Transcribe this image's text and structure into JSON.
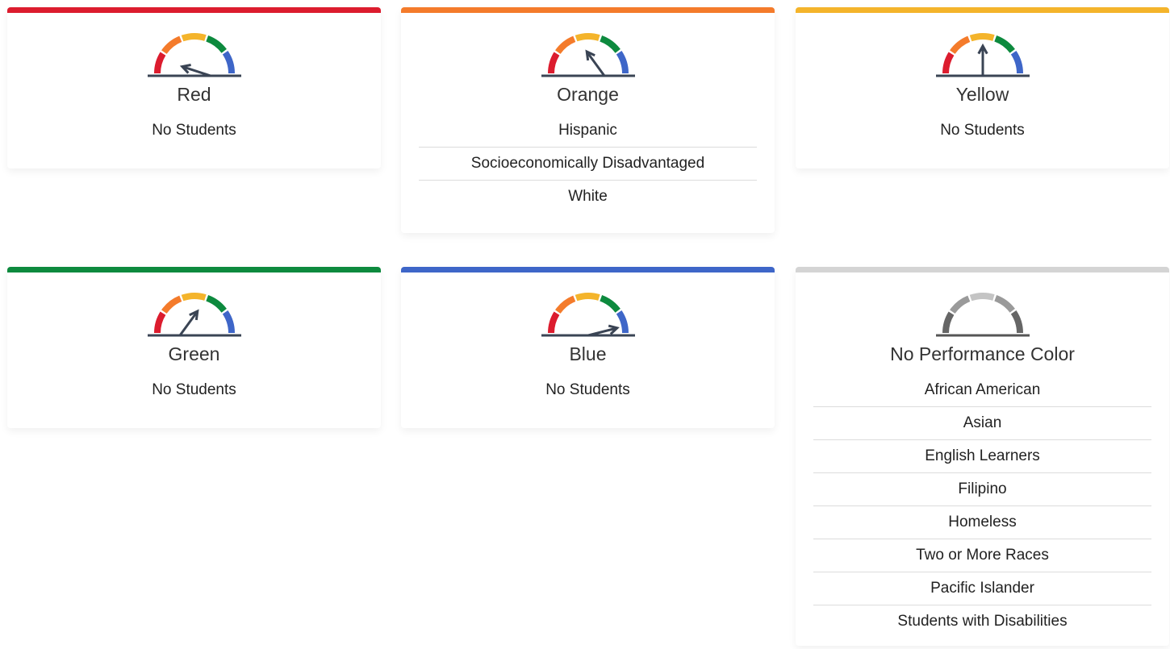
{
  "colors": {
    "red": "#dc1c2e",
    "orange": "#f47b2b",
    "yellow": "#f4b42b",
    "green": "#0d8a3e",
    "blue": "#3e66c8",
    "gray": "#d4d4d4",
    "needle": "#3a4454"
  },
  "cards": [
    {
      "key": "red",
      "title": "Red",
      "students": [
        "No Students"
      ],
      "gauge_level": 0.1
    },
    {
      "key": "orange",
      "title": "Orange",
      "students": [
        "Hispanic",
        "Socioeconomically Disadvantaged",
        "White"
      ],
      "gauge_level": 0.3
    },
    {
      "key": "yellow",
      "title": "Yellow",
      "students": [
        "No Students"
      ],
      "gauge_level": 0.5
    },
    {
      "key": "green",
      "title": "Green",
      "students": [
        "No Students"
      ],
      "gauge_level": 0.7
    },
    {
      "key": "blue",
      "title": "Blue",
      "students": [
        "No Students"
      ],
      "gauge_level": 0.92
    },
    {
      "key": "gray",
      "title": "No Performance Color",
      "students": [
        "African American",
        "Asian",
        "English Learners",
        "Filipino",
        "Homeless",
        "Two or More Races",
        "Pacific Islander",
        "Students with Disabilities"
      ],
      "gauge_level": null
    }
  ]
}
